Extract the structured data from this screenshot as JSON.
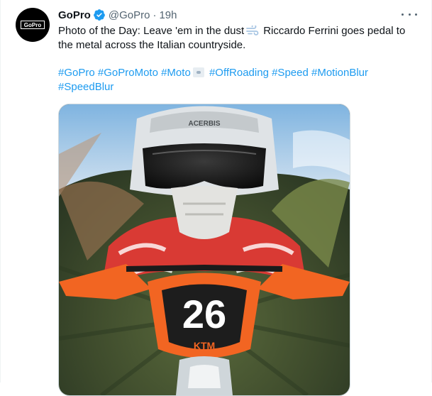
{
  "author": {
    "name": "GoPro",
    "handle": "@GoPro",
    "separator": "·",
    "time": "19h",
    "avatar_text": "GoPro"
  },
  "tweet": {
    "line1_a": "Photo of the Day: Leave 'em in the dust",
    "line1_b": "Riccardo Ferrini goes pedal to",
    "line2": "the metal across the Italian countryside."
  },
  "hashtags": [
    "#GoPro",
    "#GoProMoto",
    "#Moto",
    "#OffRoading",
    "#Speed",
    "#MotionBlur",
    "#SpeedBlur"
  ],
  "photo": {
    "number_plate": "26",
    "brand": "KTM",
    "helmet_brand": "ACERBIS"
  },
  "colors": {
    "link": "#1d9bf0",
    "verified": "#1d9bf0",
    "secondary": "#536471",
    "bike_orange": "#f26522"
  },
  "icons": {
    "verified": "verified-badge-icon",
    "more": "more-horizontal-icon",
    "emoji_dash": "dashing-away-emoji",
    "emoji_moto": "motorcycle-emoji"
  }
}
